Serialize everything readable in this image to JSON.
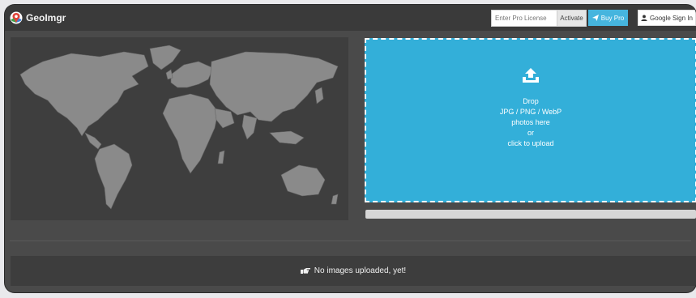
{
  "app": {
    "name": "GeoImgr"
  },
  "header": {
    "license_placeholder": "Enter Pro License",
    "activate_label": "Activate",
    "buy_pro_label": "Buy Pro",
    "sign_in_label": "Google Sign In"
  },
  "dropzone": {
    "line1": "Drop",
    "line2": "JPG / PNG / WebP",
    "line3": "photos here",
    "line4": "or",
    "line5": "click to upload"
  },
  "uploads": {
    "empty_message": "No images uploaded, yet!"
  },
  "progress": {
    "percent": 0
  },
  "colors": {
    "accent": "#33afd9",
    "buy_pro": "#46b5de",
    "panel": "#3e3e3e",
    "land": "#8a8a8a"
  },
  "icons": [
    "map-pin-logo-icon",
    "paper-plane-icon",
    "user-icon",
    "upload-icon",
    "hand-pointing-icon"
  ]
}
